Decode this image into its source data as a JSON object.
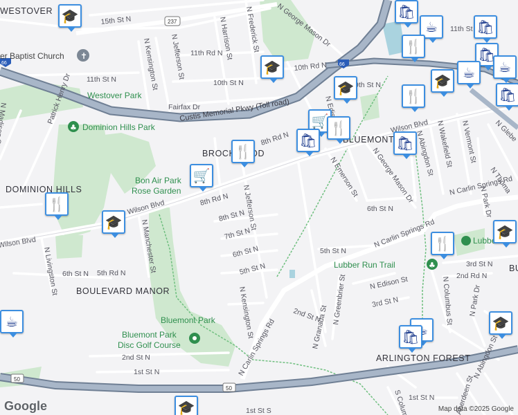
{
  "neighborhoods": {
    "westover": "WESTOVER",
    "dominion_hills": "DOMINION HILLS",
    "boulevard_manor": "BOULEVARD MANOR",
    "brockwood": "BROCKWOOD",
    "bluemont": "BLUEMONT",
    "arlington_forest": "ARLINGTON FOREST",
    "bu": "BU"
  },
  "parks": {
    "westover_park": "Westover Park",
    "dominion_hills_park": "Dominion Hills Park",
    "bon_air": "Bon Air Park Rose Garden",
    "bluemont_park": "Bluemont Park",
    "disc_golf": "Bluemont Park Disc Golf Course",
    "lubber_run_trail": "Lubber Run Trail",
    "lubber": "Lubber"
  },
  "places": {
    "church": "er Baptist Church"
  },
  "highways": {
    "custis": "Custis Memorial Pkwy (Toll road)",
    "i66": "66",
    "us50": "50",
    "rt237": "237"
  },
  "streets": {
    "s15th": "15th St N",
    "s11th_rd": "11th Rd N",
    "s11th_l": "11th St N",
    "s11th_r": "11th St N",
    "s10th_rd": "10th Rd N",
    "s10th": "10th St N",
    "s9th_r": "9th St N",
    "fairfax": "Fairfax Dr",
    "s8th_rd_a": "8th Rd N",
    "s8th_rd_b": "8th Rd N",
    "s8th_st": "8th St N",
    "s7th": "7th St N",
    "s6th_a": "6th St N",
    "s6th_b": "6th St N",
    "s6th_c": "6th St N",
    "s5th_a": "5th St N",
    "s5th_b": "5th St N",
    "s5th_rd": "5th Rd N",
    "s3rd_a": "3rd St N",
    "s3rd_b": "3rd St N",
    "s2nd_a": "2nd St N",
    "s2nd_b": "2nd St N",
    "s2nd_rd": "2nd Rd N",
    "s1st_a": "1st St N",
    "s1st_b": "1st St N",
    "s1st_s": "1st St S",
    "wilson_l": "Wilson Blvd",
    "wilson_c": "Wilson Blvd",
    "wilson_r": "Wilson Blvd",
    "jefferson_top": "N Jefferson St",
    "kensington_top": "N Kensington St",
    "harrison": "N Harrison St",
    "frederick": "N Frederick St",
    "george_mason_top": "N George Mason Dr",
    "george_mason_mid": "N George Mason Dr",
    "madison": "N Madison St",
    "patrick_henry": "Patrick Henry Dr",
    "manchester": "N Manchester St",
    "livingston": "N Livingston St",
    "jefferson_mid": "N Jefferson St",
    "kensington_mid": "N Kensington St",
    "carlin_springs_main": "N Carlin Springs Rd",
    "carlin_springs_ne": "N Carlin Springs Rd",
    "carlin_springs_e": "N Carlin Springs Rd",
    "emerson": "N Emerson St",
    "edison_n": "N Edison St",
    "edison": "N Edison St",
    "greenbrier": "N Greenbrier St",
    "granada": "N Granada St",
    "abingdon_n": "N Abingdon St",
    "abingdon_s": "N Abingdon St",
    "wakefield": "N Wakefield St",
    "vermont": "N Vermont St",
    "glebe": "N Glebe",
    "thomas": "N Thoma",
    "park_dr_n": "N Park Dr",
    "park_dr_s": "N Park Dr",
    "columbus": "N Columbus St",
    "aberdeen": "Aberdeen St",
    "s_columbus": "S Columbu"
  },
  "markers": [
    {
      "type": "school",
      "icon": "school-icon"
    },
    {
      "type": "shopping",
      "icon": "shopping-bag-icon"
    },
    {
      "type": "cafe",
      "icon": "cafe-icon"
    },
    {
      "type": "shopping",
      "icon": "shopping-bag-icon"
    },
    {
      "type": "restaurant",
      "icon": "restaurant-icon"
    },
    {
      "type": "shopping",
      "icon": "shopping-bag-icon"
    },
    {
      "type": "cafe",
      "icon": "cafe-icon"
    },
    {
      "type": "cafe",
      "icon": "cafe-icon"
    },
    {
      "type": "school",
      "icon": "school-icon"
    },
    {
      "type": "school",
      "icon": "school-icon"
    },
    {
      "type": "school",
      "icon": "school-icon"
    },
    {
      "type": "restaurant",
      "icon": "restaurant-icon"
    },
    {
      "type": "shopping",
      "icon": "shopping-bag-icon"
    },
    {
      "type": "grocery",
      "icon": "shopping-cart-icon"
    },
    {
      "type": "restaurant",
      "icon": "restaurant-icon"
    },
    {
      "type": "shopping",
      "icon": "shopping-bag-icon"
    },
    {
      "type": "restaurant",
      "icon": "restaurant-icon"
    },
    {
      "type": "grocery",
      "icon": "shopping-cart-icon"
    },
    {
      "type": "school",
      "icon": "school-icon"
    },
    {
      "type": "restaurant",
      "icon": "restaurant-icon"
    },
    {
      "type": "school",
      "icon": "school-icon"
    },
    {
      "type": "restaurant",
      "icon": "restaurant-icon"
    },
    {
      "type": "cafe",
      "icon": "cafe-icon"
    },
    {
      "type": "cafe",
      "icon": "cafe-icon"
    },
    {
      "type": "shopping",
      "icon": "shopping-bag-icon"
    },
    {
      "type": "school",
      "icon": "school-icon"
    },
    {
      "type": "school",
      "icon": "school-icon"
    }
  ],
  "footer": {
    "logo": "Google",
    "attribution": "Map data ©2025 Google"
  },
  "colors": {
    "park": "#cfe8cf",
    "highway": "#a8b6c8",
    "highway_casing": "#6f7f94",
    "water": "#aad3df",
    "marker_border": "#3c8ee0",
    "marker_icon": "#1b3a8c"
  }
}
